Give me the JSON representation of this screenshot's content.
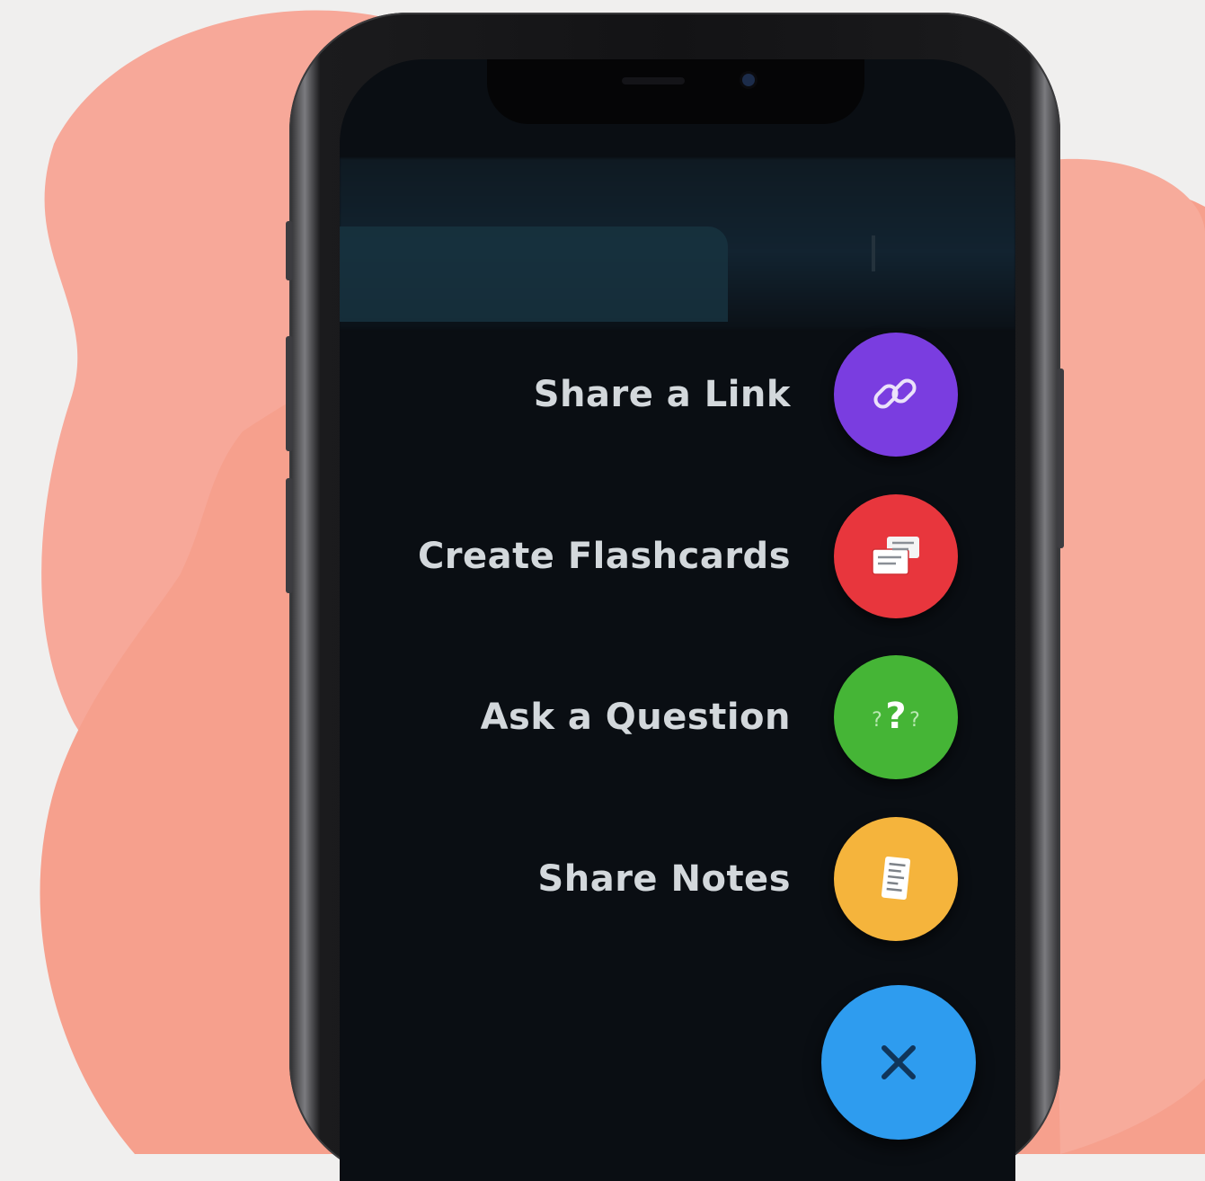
{
  "menu": {
    "items": [
      {
        "label": "Share a Link",
        "icon": "link-icon",
        "color": "#7a3de0"
      },
      {
        "label": "Create Flashcards",
        "icon": "flashcards-icon",
        "color": "#e8363d"
      },
      {
        "label": "Ask a Question",
        "icon": "question-icon",
        "color": "#45b536"
      },
      {
        "label": "Share Notes",
        "icon": "notes-icon",
        "color": "#f5b43c"
      }
    ],
    "close": {
      "icon": "close-icon",
      "color": "#2e9cef"
    }
  },
  "colors": {
    "background": "#f0efee",
    "blob": "#f7a899",
    "screen": "#0a0e13"
  }
}
